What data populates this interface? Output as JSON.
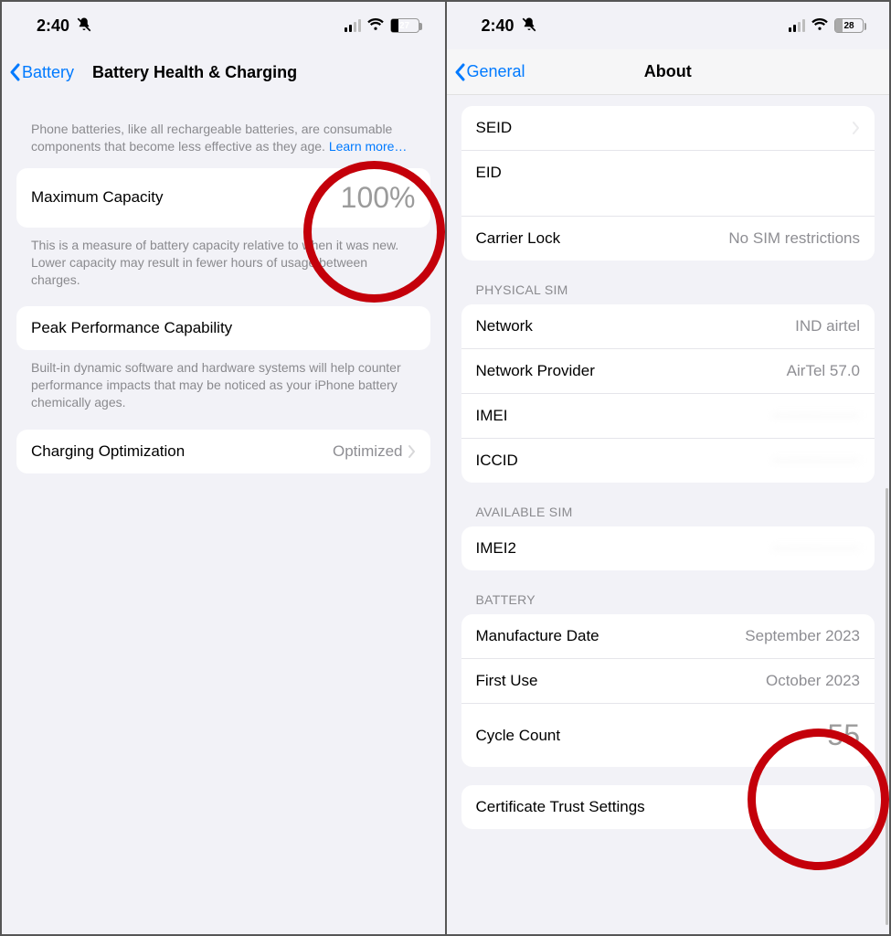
{
  "status": {
    "time": "2:40",
    "battery_left": "27",
    "battery_right": "28"
  },
  "left_screen": {
    "back_label": "Battery",
    "title": "Battery Health & Charging",
    "intro_note": "Phone batteries, like all rechargeable batteries, are consumable components that become less effective as they age. ",
    "learn_more": "Learn more…",
    "max_capacity_label": "Maximum Capacity",
    "max_capacity_value": "100%",
    "max_note": "This is a measure of battery capacity relative to when it was new. Lower capacity may result in fewer hours of usage between charges.",
    "peak_label": "Peak Performance Capability",
    "peak_note": "Built-in dynamic software and hardware systems will help counter performance impacts that may be noticed as your iPhone battery chemically ages.",
    "charging_opt_label": "Charging Optimization",
    "charging_opt_value": "Optimized"
  },
  "right_screen": {
    "back_label": "General",
    "title": "About",
    "seid_label": "SEID",
    "eid_label": "EID",
    "carrier_lock_label": "Carrier Lock",
    "carrier_lock_value": "No SIM restrictions",
    "physical_sim_header": "PHYSICAL SIM",
    "network_label": "Network",
    "network_value": "IND airtel",
    "provider_label": "Network Provider",
    "provider_value": "AirTel 57.0",
    "imei_label": "IMEI",
    "iccid_label": "ICCID",
    "available_sim_header": "AVAILABLE SIM",
    "imei2_label": "IMEI2",
    "battery_header": "BATTERY",
    "manufacture_label": "Manufacture Date",
    "manufacture_value": "September 2023",
    "first_use_label": "First Use",
    "first_use_value": "October 2023",
    "cycle_label": "Cycle Count",
    "cycle_value": "55",
    "cert_label": "Certificate Trust Settings"
  }
}
